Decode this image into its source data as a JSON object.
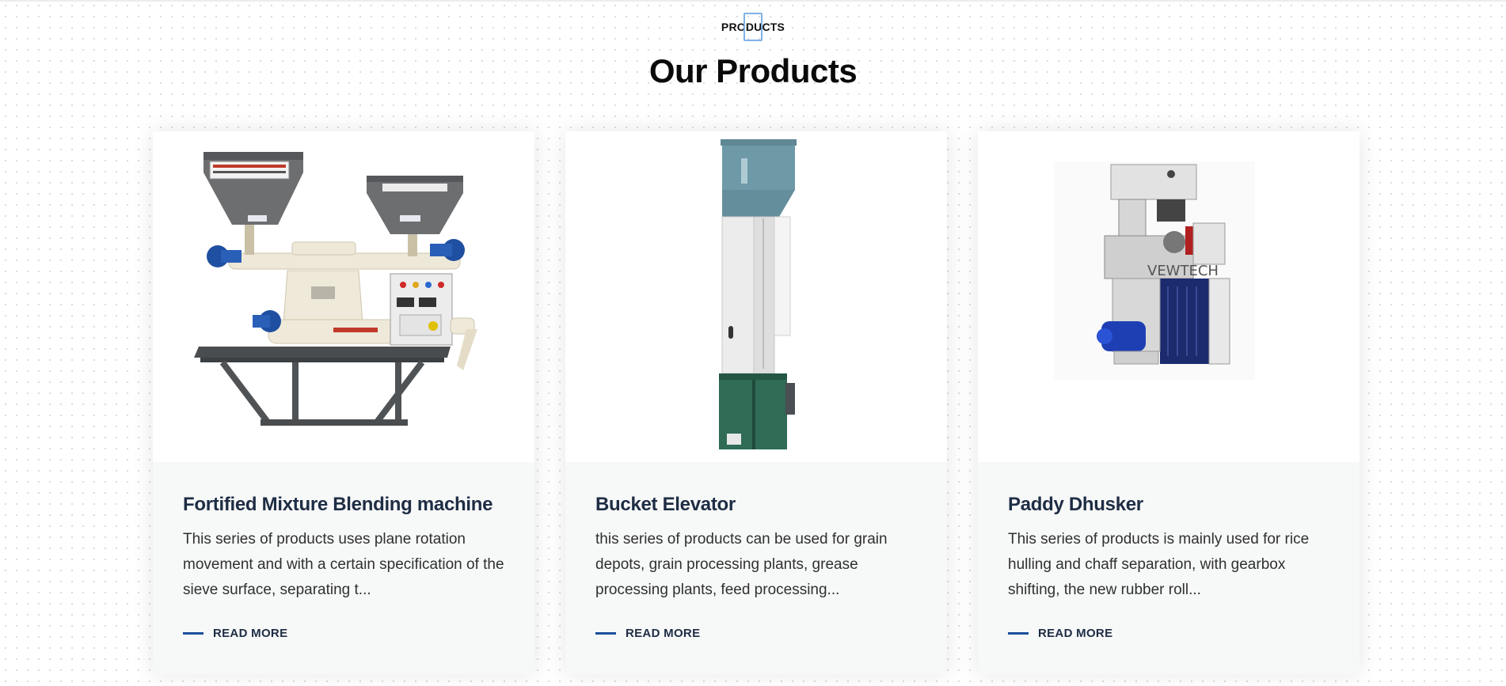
{
  "section": {
    "eyebrow": "PRODUCTS",
    "heading": "Our Products"
  },
  "products": [
    {
      "title": "Fortified Mixture Blending machine",
      "description": "This series of products uses plane rotation movement and with a certain specification of the sieve surface, separating t...",
      "link_label": "READ MORE",
      "image_icon": "blending-machine-image"
    },
    {
      "title": "Bucket Elevator",
      "description": "this series of products can be used for grain depots, grain processing plants, grease processing plants, feed processing...",
      "link_label": "READ MORE",
      "image_icon": "bucket-elevator-image"
    },
    {
      "title": "Paddy Dhusker",
      "description": "This series of products is mainly used for rice hulling and chaff separation, with gearbox shifting, the new rubber roll...",
      "link_label": "READ MORE",
      "image_icon": "paddy-dehusker-image",
      "image_watermark": "VEWTECH"
    }
  ],
  "colors": {
    "accent": "#1b4f9b",
    "title": "#1e2d44",
    "card_bg": "#f7f8f8"
  }
}
